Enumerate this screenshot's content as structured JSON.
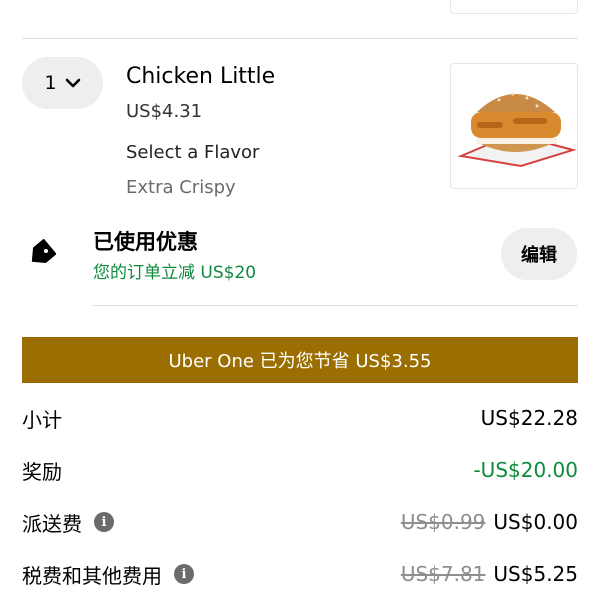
{
  "item": {
    "quantity": "1",
    "name": "Chicken Little",
    "price": "US$4.31",
    "flavor_label": "Select a Flavor",
    "flavor_value": "Extra Crispy"
  },
  "promo": {
    "title": "已使用优惠",
    "subtitle": "您的订单立减 US$20",
    "edit_label": "编辑"
  },
  "uber_one": {
    "text": "Uber One 已为您节省 US$3.55",
    "color": "#9a6e00"
  },
  "summary": {
    "subtotal": {
      "label": "小计",
      "value": "US$22.28"
    },
    "rewards": {
      "label": "奖励",
      "value": "-US$20.00"
    },
    "delivery": {
      "label": "派送费",
      "old_value": "US$0.99",
      "value": "US$0.00"
    },
    "taxes": {
      "label": "税费和其他费用",
      "old_value": "US$7.81",
      "value": "US$5.25"
    }
  },
  "icons": {
    "quantity_dropdown": "chevron-down-icon",
    "promo": "tag-icon",
    "info": "info-icon"
  },
  "colors": {
    "discount_green": "#0e8a3c",
    "pill_bg": "#eeeeee"
  }
}
